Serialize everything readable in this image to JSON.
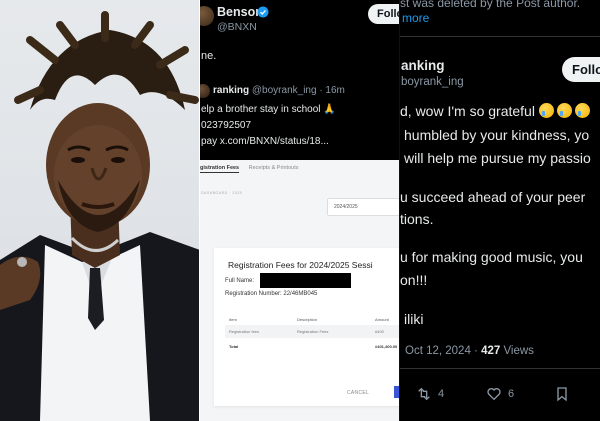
{
  "middle_tweet": {
    "display_name": "Benson",
    "handle": "@BNXN",
    "follow_label": "Follo",
    "text_fragment": "ne.",
    "quote": {
      "name": "ranking",
      "handle": "@boyrank_ing · 16m",
      "lines": [
        "elp a brother stay in school 🙏",
        "023792507",
        "pay  x.com/BNXN/status/18..."
      ]
    }
  },
  "registration_form": {
    "tab_active": "gistration Fees",
    "tab_other": "Receipts & Printouts",
    "sub_header": "DASHBOARD  ·  2025",
    "session_value": "2024/2025",
    "title": "Registration Fees for 2024/2025 Sessi",
    "full_name_label": "Full Name:",
    "reg_number": "Registration Number: 22/46MB045",
    "table_headers": [
      "Item",
      "Description",
      "Amount"
    ],
    "row": [
      "Registration fees",
      "Registration Fees",
      "#400"
    ],
    "total_label": "Total",
    "total_value": "#401,400.00",
    "cancel_label": "CANCEL"
  },
  "right_tweet": {
    "deleted_notice": "st was deleted by the Post author.",
    "show_more": "more",
    "name": "anking",
    "handle": "boyrank_ing",
    "follow_label": "Follo",
    "lines": [
      "d, wow I'm so grateful",
      "humbled by your kindness, yo",
      "will help me pursue my passio",
      "u succeed ahead of your peer",
      "tions.",
      "u for making good music, you",
      "on!!!",
      "iliki"
    ],
    "timestamp": "Oct 12, 2024 ·",
    "views_count": "427",
    "views_label": "Views",
    "retweets": "4",
    "likes": "6"
  },
  "colors": {
    "background": "#000000",
    "text": "#e7e9ea",
    "muted": "#8b98a5",
    "link": "#1d9bf0",
    "verified": "#1d9bf0"
  }
}
